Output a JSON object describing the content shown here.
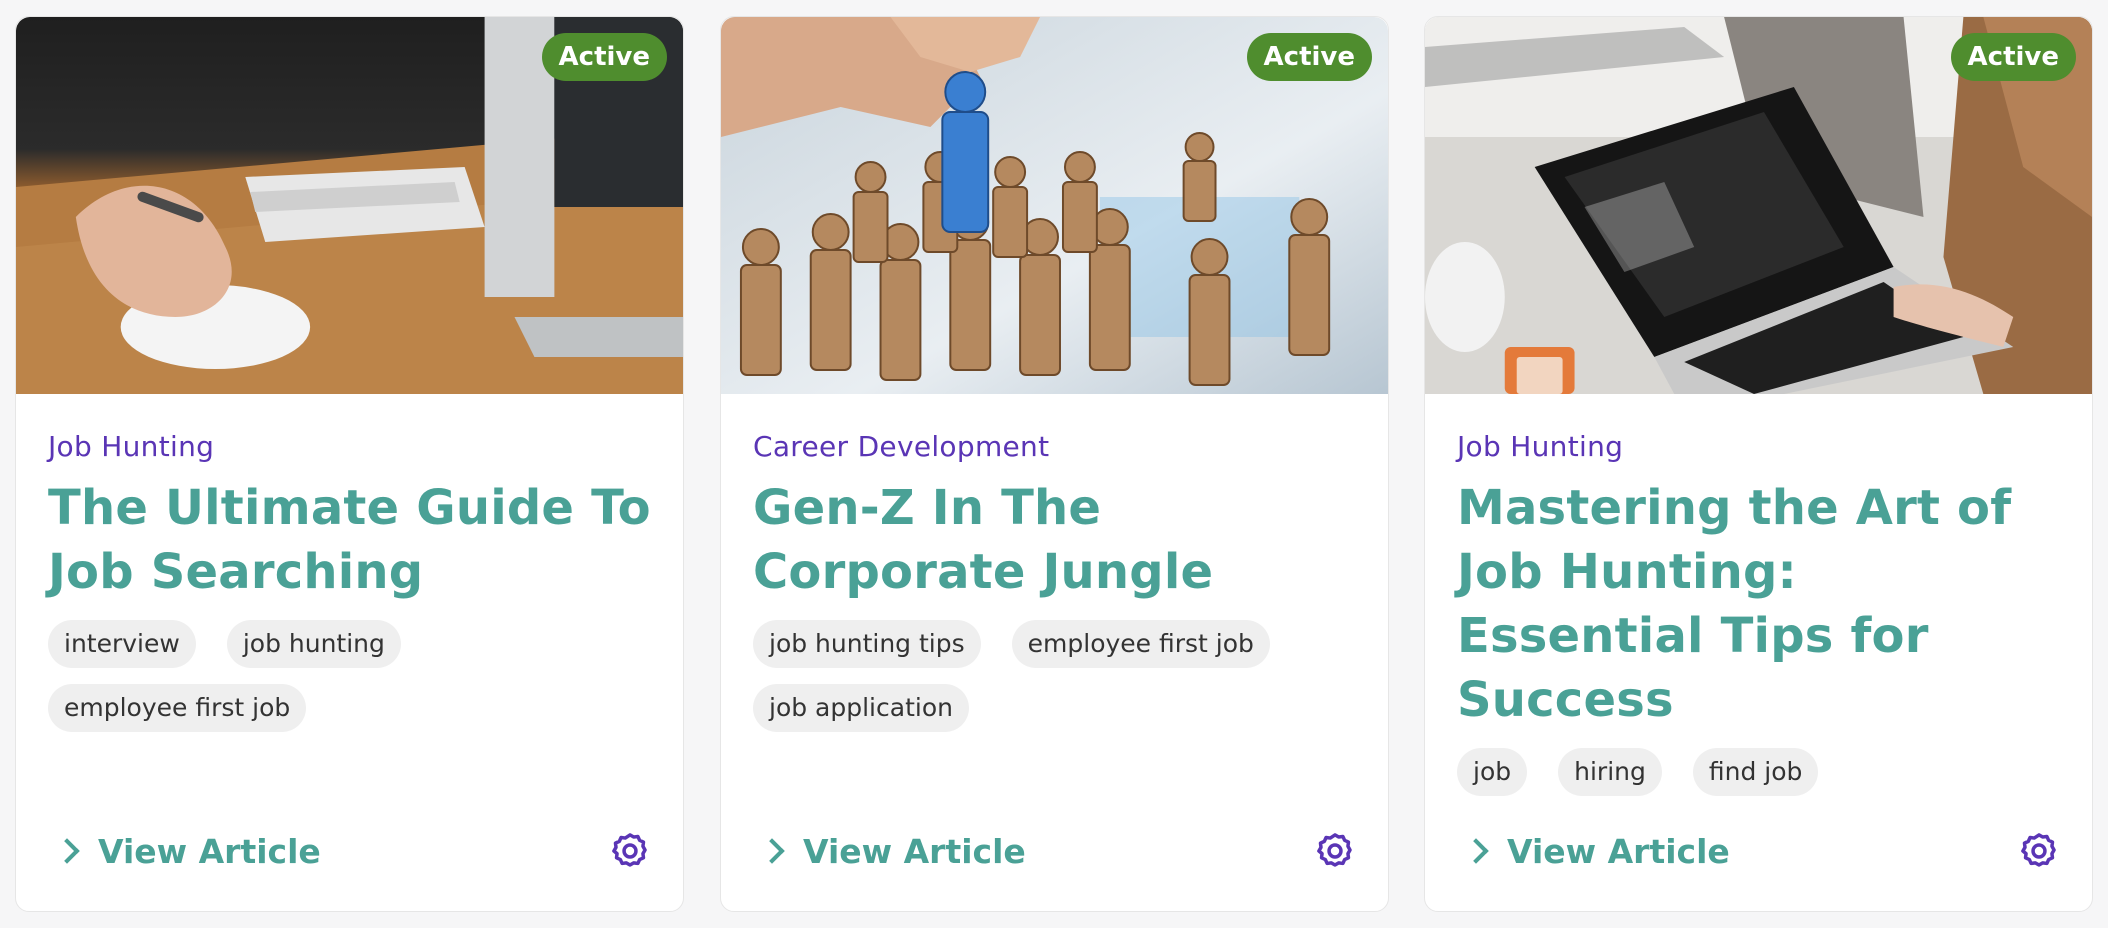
{
  "colors": {
    "active_badge": "#4f8d2e",
    "category": "#5a35b5",
    "title": "#4aa196",
    "gear": "#5a35b5"
  },
  "cards": [
    {
      "image_alt": "hand using mouse at desk",
      "status": "Active",
      "category": "Job Hunting",
      "title": "The Ultimate Guide To Job Searching",
      "tags": [
        "interview",
        "job hunting",
        "employee first job"
      ],
      "link_label": "View Article",
      "settings_icon": "gear-icon"
    },
    {
      "image_alt": "wooden figures with one blue figure",
      "status": "Active",
      "category": "Career Development",
      "title": "Gen-Z In The Corporate Jungle",
      "tags": [
        "job hunting tips",
        "employee first job",
        "job application"
      ],
      "link_label": "View Article",
      "settings_icon": "gear-icon"
    },
    {
      "image_alt": "person typing on laptop",
      "status": "Active",
      "category": "Job Hunting",
      "title": "Mastering the Art of Job Hunting: Essential Tips for Success",
      "tags": [
        "job",
        "hiring",
        "find job"
      ],
      "link_label": "View Article",
      "settings_icon": "gear-icon"
    }
  ]
}
